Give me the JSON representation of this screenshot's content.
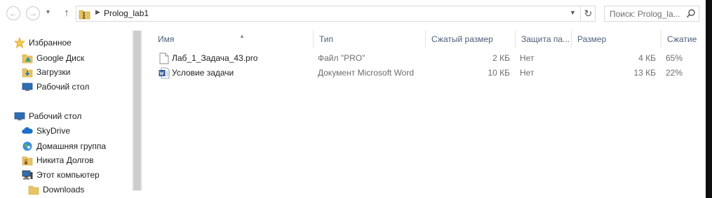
{
  "address_bar": {
    "path": "Prolog_lab1",
    "search_placeholder": "Поиск: Prolog_la..."
  },
  "nav_pane": {
    "favorites": {
      "label": "Избранное",
      "items": [
        {
          "label": "Google Диск",
          "icon": "google-drive-folder-icon"
        },
        {
          "label": "Загрузки",
          "icon": "downloads-folder-icon"
        },
        {
          "label": "Рабочий стол",
          "icon": "desktop-icon"
        }
      ]
    },
    "desktop": {
      "label": "Рабочий стол",
      "items": [
        {
          "label": "SkyDrive",
          "icon": "skydrive-cloud-icon"
        },
        {
          "label": "Домашняя группа",
          "icon": "homegroup-icon"
        },
        {
          "label": "Никита Долгов",
          "icon": "user-folder-icon"
        },
        {
          "label": "Этот компьютер",
          "icon": "computer-icon"
        },
        {
          "label": "Downloads",
          "icon": "folder-icon"
        }
      ]
    }
  },
  "columns": [
    "Имя",
    "Тип",
    "Сжатый размер",
    "Защита па...",
    "Размер",
    "Сжатие"
  ],
  "files": [
    {
      "name": "Лаб_1_Задача_43.pro",
      "type": "Файл \"PRO\"",
      "compressed": "2 КБ",
      "protected": "Нет",
      "size": "4 КБ",
      "ratio": "65%",
      "icon": "document-file-icon"
    },
    {
      "name": "Условие задачи",
      "type": "Документ Microsoft Word",
      "compressed": "10 КБ",
      "protected": "Нет",
      "size": "13 КБ",
      "ratio": "22%",
      "icon": "word-document-icon"
    }
  ],
  "colors": {
    "header_text": "#4c607a",
    "meta_text": "#6d6d6d",
    "folder_yellow": "#e8c462",
    "accent_blue": "#1e6fc8"
  }
}
